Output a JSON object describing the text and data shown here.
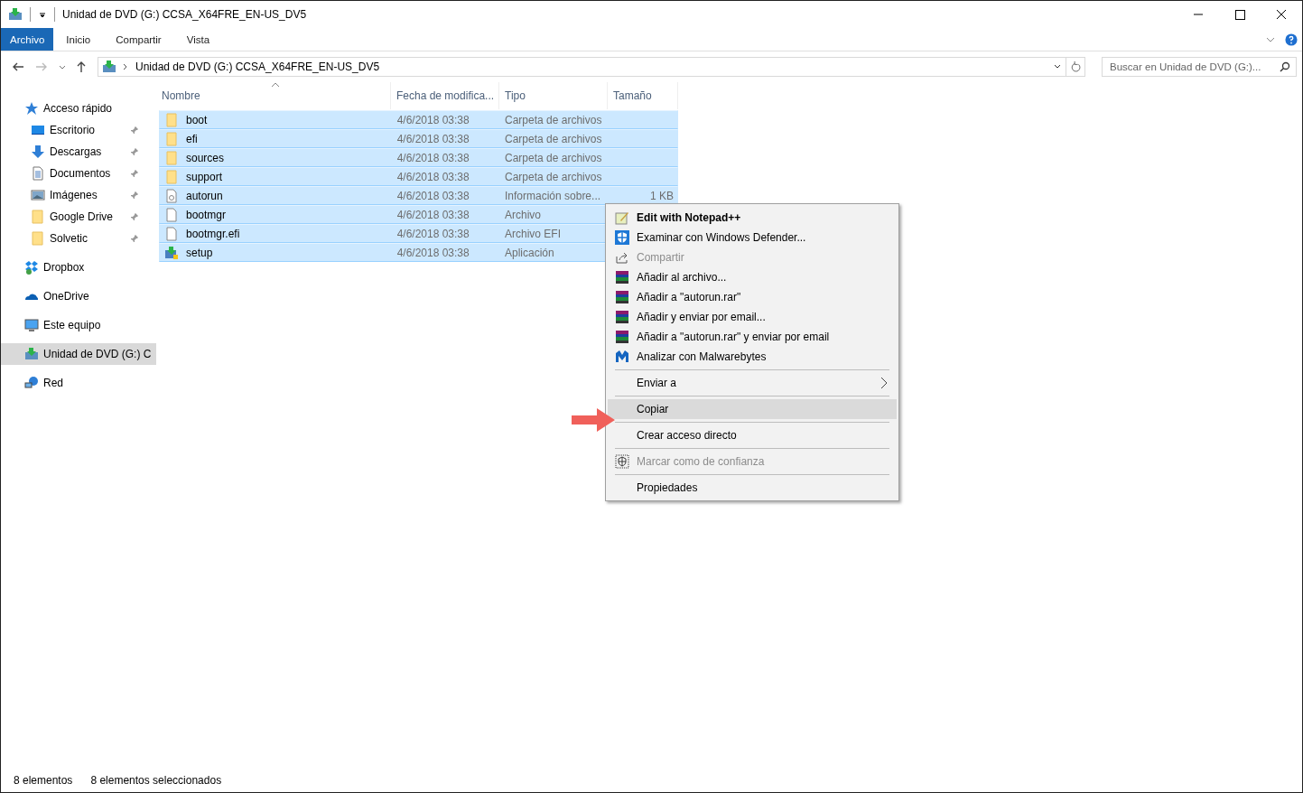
{
  "window": {
    "title": "Unidad de DVD (G:) CCSA_X64FRE_EN-US_DV5"
  },
  "ribbon_tabs": [
    {
      "label": "Archivo",
      "selected": true
    },
    {
      "label": "Inicio",
      "selected": false
    },
    {
      "label": "Compartir",
      "selected": false
    },
    {
      "label": "Vista",
      "selected": false
    }
  ],
  "address_bar": {
    "path": "Unidad de DVD (G:) CCSA_X64FRE_EN-US_DV5"
  },
  "search": {
    "placeholder": "Buscar en Unidad de DVD (G:)..."
  },
  "sidebar": {
    "items": [
      {
        "label": "Acceso rápido",
        "kind": "star",
        "selected": false,
        "children": [
          {
            "label": "Escritorio",
            "kind": "desktop",
            "pinned": true,
            "selected": false
          },
          {
            "label": "Descargas",
            "kind": "download",
            "pinned": true,
            "selected": false
          },
          {
            "label": "Documentos",
            "kind": "document",
            "pinned": true,
            "selected": false
          },
          {
            "label": "Imágenes",
            "kind": "image",
            "pinned": true,
            "selected": false
          },
          {
            "label": "Google Drive",
            "kind": "folder",
            "pinned": true,
            "selected": false
          },
          {
            "label": "Solvetic",
            "kind": "folder",
            "pinned": true,
            "selected": false
          }
        ]
      },
      {
        "label": "Dropbox",
        "kind": "dropbox",
        "selected": false
      },
      {
        "label": "OneDrive",
        "kind": "cloud",
        "selected": false
      },
      {
        "label": "Este equipo",
        "kind": "computer",
        "selected": false
      },
      {
        "label": "Unidad de DVD (G:) C",
        "kind": "dvd",
        "selected": true
      },
      {
        "label": "Red",
        "kind": "network",
        "selected": false
      }
    ]
  },
  "table": {
    "columns": [
      "Nombre",
      "Fecha de modifica...",
      "Tipo",
      "Tamaño"
    ],
    "rows": [
      {
        "name": "boot",
        "date": "4/6/2018 03:38",
        "type": "Carpeta de archivos",
        "kind": "folder",
        "selected": true
      },
      {
        "name": "efi",
        "date": "4/6/2018 03:38",
        "type": "Carpeta de archivos",
        "kind": "folder",
        "selected": true
      },
      {
        "name": "sources",
        "date": "4/6/2018 03:38",
        "type": "Carpeta de archivos",
        "kind": "folder",
        "selected": true
      },
      {
        "name": "support",
        "date": "4/6/2018 03:38",
        "type": "Carpeta de archivos",
        "kind": "folder",
        "selected": true
      },
      {
        "name": "autorun",
        "date": "4/6/2018 03:38",
        "type": "Información sobre...",
        "size": "1 KB",
        "kind": "config",
        "selected": true
      },
      {
        "name": "bootmgr",
        "date": "4/6/2018 03:38",
        "type": "Archivo",
        "kind": "file",
        "selected": true
      },
      {
        "name": "bootmgr.efi",
        "date": "4/6/2018 03:38",
        "type": "Archivo EFI",
        "kind": "file",
        "selected": true
      },
      {
        "name": "setup",
        "date": "4/6/2018 03:38",
        "type": "Aplicación",
        "kind": "app",
        "selected": true
      }
    ]
  },
  "context_menu": {
    "sections": [
      [
        {
          "label": "Edit with Notepad++",
          "kind": "notepad",
          "bold": true,
          "disabled": false,
          "selected": false
        },
        {
          "label": "Examinar con Windows Defender...",
          "kind": "shield",
          "disabled": false,
          "selected": false
        },
        {
          "label": "Compartir",
          "kind": "share",
          "disabled": true,
          "selected": false
        },
        {
          "label": "Añadir al archivo...",
          "kind": "books",
          "disabled": false,
          "selected": false
        },
        {
          "label": "Añadir a \"autorun.rar\"",
          "kind": "books",
          "disabled": false,
          "selected": false
        },
        {
          "label": "Añadir y enviar por email...",
          "kind": "books",
          "disabled": false,
          "selected": false
        },
        {
          "label": "Añadir a \"autorun.rar\" y enviar por email",
          "kind": "books",
          "disabled": false,
          "selected": false
        },
        {
          "label": "Analizar con Malwarebytes",
          "kind": "malware",
          "disabled": false,
          "selected": false
        }
      ],
      [
        {
          "label": "Enviar a",
          "submenu": true,
          "disabled": false,
          "selected": false
        }
      ],
      [
        {
          "label": "Copiar",
          "disabled": false,
          "selected": true
        }
      ],
      [
        {
          "label": "Crear acceso directo",
          "disabled": false,
          "selected": false
        }
      ],
      [
        {
          "label": "Marcar como de confianza",
          "kind": "trust",
          "disabled": true,
          "selected": false
        }
      ],
      [
        {
          "label": "Propiedades",
          "disabled": false,
          "selected": false
        }
      ]
    ]
  },
  "status_bar": {
    "count": "8 elementos",
    "selection": "8 elementos seleccionados"
  }
}
